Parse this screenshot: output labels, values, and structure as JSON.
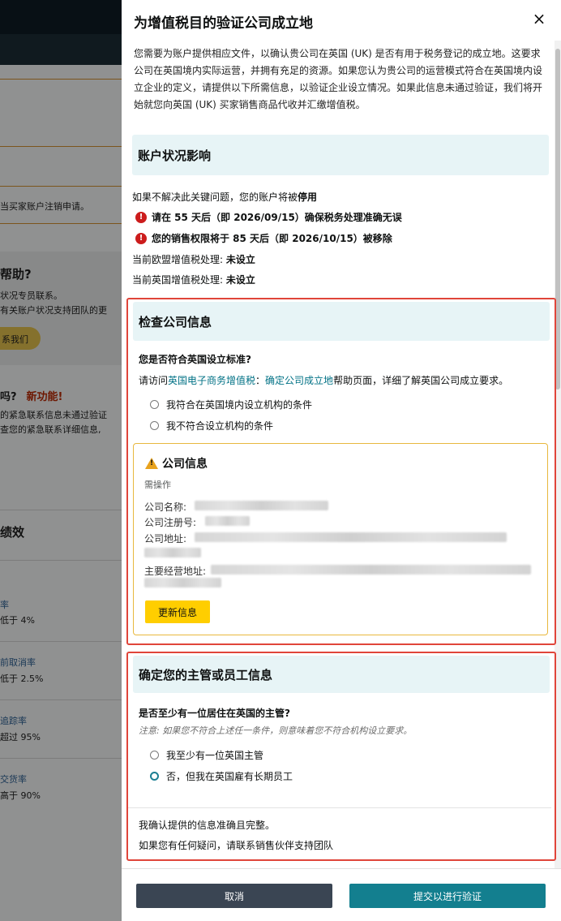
{
  "background": {
    "text_cancel_req": "当买家账户注销申请。",
    "help_title": "帮助?",
    "help_line1": "状况专员联系。",
    "help_line2": "有关账户状况支持团队的更",
    "contact_btn": "系我们",
    "q_title": "吗?",
    "new_feature": "新功能!",
    "emg_line1": "的紧急联系信息未通过验证",
    "emg_line2": "查您的紧急联系详细信息,",
    "perf_title": "绩效",
    "metric1_name": "率",
    "metric1_target": "低于 4%",
    "metric2_name": "前取消率",
    "metric2_target": "低于 2.5%",
    "metric3_name": "追踪率",
    "metric3_target": "超过 95%",
    "metric4_name": "交货率",
    "metric4_target": "高于 90%"
  },
  "modal": {
    "title": "为增值税目的验证公司成立地",
    "close_label": "×",
    "intro": "您需要为账户提供相应文件，以确认贵公司在英国 (UK) 是否有用于税务登记的成立地。这要求公司在英国境内实际运营，并拥有充足的资源。如果您认为贵公司的运营模式符合在英国境内设立企业的定义，请提供以下所需信息，以验证企业设立情况。如果此信息未通过验证，我们将开始就您向英国 (UK) 买家销售商品代收并汇缴增值税。",
    "account_section": {
      "heading": "账户状况影响",
      "status_prefix": "如果不解决此关键问题，您的账户将被",
      "status_word": "停用",
      "alert1": "请在 55 天后（即 2026/09/15）确保税务处理准确无误",
      "alert2": "您的销售权限将于 85 天后（即 2026/10/15）被移除",
      "eu_label": "当前欧盟增值税处理: ",
      "eu_value": "未设立",
      "uk_label": "当前英国增值税处理: ",
      "uk_value": "未设立"
    },
    "company_section": {
      "heading": "检查公司信息",
      "question": "您是否符合英国设立标准?",
      "help_prefix": "请访问",
      "help_link1": "英国电子商务增值税",
      "help_sep": "：",
      "help_link2": "确定公司成立地",
      "help_suffix": "帮助页面，详细了解英国公司成立要求。",
      "option_yes": "我符合在英国境内设立机构的条件",
      "option_no": "我不符合设立机构的条件",
      "card": {
        "title": "公司信息",
        "subtitle": "需操作",
        "name_label": "公司名称:",
        "reg_label": "公司注册号:",
        "addr_label": "公司地址:",
        "main_addr_label": "主要经营地址:",
        "update_btn": "更新信息"
      }
    },
    "director_section": {
      "heading": "确定您的主管或员工信息",
      "question": "是否至少有一位居住在英国的主管?",
      "note_label": "注意:",
      "note_text": "如果您不符合上述任一条件，则意味着您不符合机构设立要求。",
      "option_director": "我至少有一位英国主管",
      "option_employee": "否，但我在英国雇有长期员工",
      "confirm": "我确认提供的信息准确且完整。",
      "contact": "如果您有任何疑问，请联系销售伙伴支持团队"
    },
    "footer": {
      "cancel": "取消",
      "submit": "提交以进行验证"
    }
  }
}
